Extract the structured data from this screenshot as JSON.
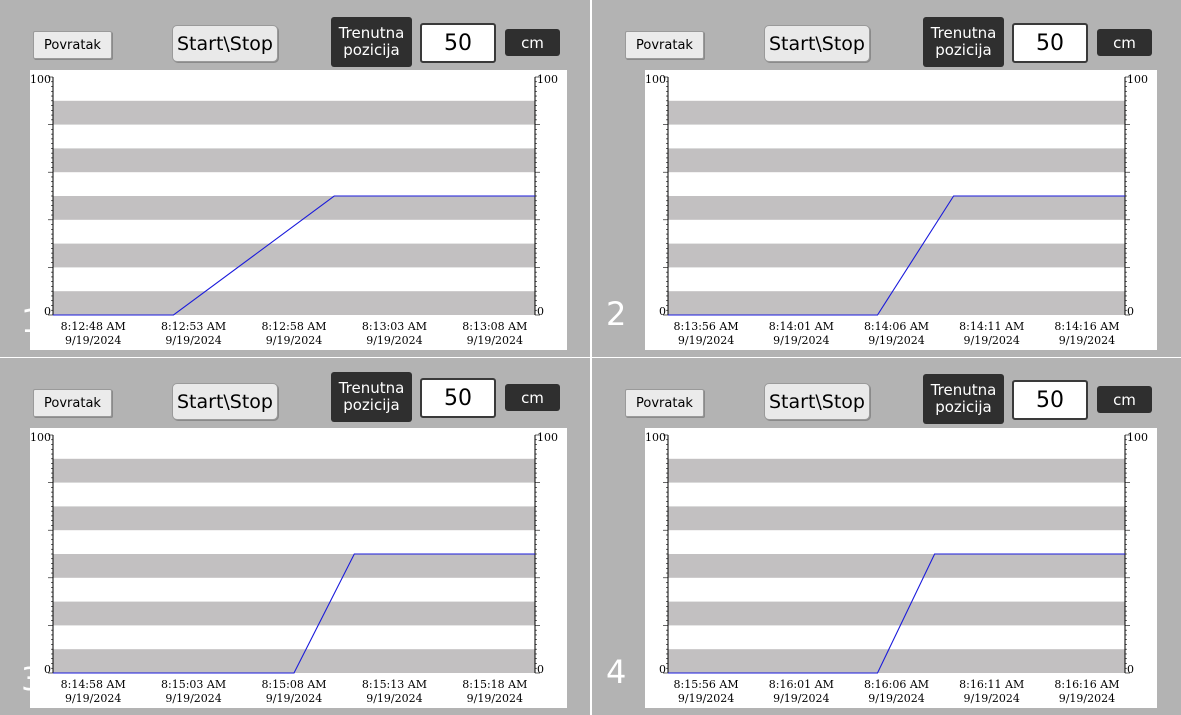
{
  "panels": [
    {
      "number": "1",
      "back_label": "Povratak",
      "startstop_label": "Start\\Stop",
      "position_label": "Trenutna\npozicija",
      "position_value": "50",
      "unit": "cm",
      "chart_data": {
        "type": "line",
        "y_left_labels": [
          "100",
          "0"
        ],
        "y_right_labels": [
          "100",
          "0"
        ],
        "ylim": [
          0,
          100
        ],
        "x_ticks": [
          {
            "time": "8:12:48 AM",
            "date": "9/19/2024"
          },
          {
            "time": "8:12:53 AM",
            "date": "9/19/2024"
          },
          {
            "time": "8:12:58 AM",
            "date": "9/19/2024"
          },
          {
            "time": "8:13:03 AM",
            "date": "9/19/2024"
          },
          {
            "time": "8:13:08 AM",
            "date": "9/19/2024"
          }
        ],
        "series": [
          {
            "color": "#1a1adb",
            "points": [
              [
                "8:12:46 AM",
                0
              ],
              [
                "8:12:52 AM",
                0
              ],
              [
                "8:13:00 AM",
                50
              ],
              [
                "8:13:10 AM",
                50
              ]
            ]
          }
        ],
        "grid": "alternating bands"
      }
    },
    {
      "number": "2",
      "back_label": "Povratak",
      "startstop_label": "Start\\Stop",
      "position_label": "Trenutna\npozicija",
      "position_value": "50",
      "unit": "cm",
      "chart_data": {
        "type": "line",
        "y_left_labels": [
          "100",
          "0"
        ],
        "y_right_labels": [
          "100",
          "0"
        ],
        "ylim": [
          0,
          100
        ],
        "x_ticks": [
          {
            "time": "8:13:56 AM",
            "date": "9/19/2024"
          },
          {
            "time": "8:14:01 AM",
            "date": "9/19/2024"
          },
          {
            "time": "8:14:06 AM",
            "date": "9/19/2024"
          },
          {
            "time": "8:14:11 AM",
            "date": "9/19/2024"
          },
          {
            "time": "8:14:16 AM",
            "date": "9/19/2024"
          }
        ],
        "series": [
          {
            "color": "#1a1adb",
            "points": [
              [
                "8:13:54 AM",
                0
              ],
              [
                "8:14:05 AM",
                0
              ],
              [
                "8:14:09 AM",
                50
              ],
              [
                "8:14:18 AM",
                50
              ]
            ]
          }
        ],
        "grid": "alternating bands"
      }
    },
    {
      "number": "3",
      "back_label": "Povratak",
      "startstop_label": "Start\\Stop",
      "position_label": "Trenutna\npozicija",
      "position_value": "50",
      "unit": "cm",
      "chart_data": {
        "type": "line",
        "y_left_labels": [
          "100",
          "0"
        ],
        "y_right_labels": [
          "100",
          "0"
        ],
        "ylim": [
          0,
          100
        ],
        "x_ticks": [
          {
            "time": "8:14:58 AM",
            "date": "9/19/2024"
          },
          {
            "time": "8:15:03 AM",
            "date": "9/19/2024"
          },
          {
            "time": "8:15:08 AM",
            "date": "9/19/2024"
          },
          {
            "time": "8:15:13 AM",
            "date": "9/19/2024"
          },
          {
            "time": "8:15:18 AM",
            "date": "9/19/2024"
          }
        ],
        "series": [
          {
            "color": "#1a1adb",
            "points": [
              [
                "8:14:56 AM",
                0
              ],
              [
                "8:15:08 AM",
                0
              ],
              [
                "8:15:11 AM",
                50
              ],
              [
                "8:15:20 AM",
                50
              ]
            ]
          }
        ],
        "grid": "alternating bands"
      }
    },
    {
      "number": "4",
      "back_label": "Povratak",
      "startstop_label": "Start\\Stop",
      "position_label": "Trenutna\npozicija",
      "position_value": "50",
      "unit": "cm",
      "chart_data": {
        "type": "line",
        "y_left_labels": [
          "100",
          "0"
        ],
        "y_right_labels": [
          "100",
          "0"
        ],
        "ylim": [
          0,
          100
        ],
        "x_ticks": [
          {
            "time": "8:15:56 AM",
            "date": "9/19/2024"
          },
          {
            "time": "8:16:01 AM",
            "date": "9/19/2024"
          },
          {
            "time": "8:16:06 AM",
            "date": "9/19/2024"
          },
          {
            "time": "8:16:11 AM",
            "date": "9/19/2024"
          },
          {
            "time": "8:16:16 AM",
            "date": "9/19/2024"
          }
        ],
        "series": [
          {
            "color": "#1a1adb",
            "points": [
              [
                "8:15:54 AM",
                0
              ],
              [
                "8:16:05 AM",
                0
              ],
              [
                "8:16:08 AM",
                50
              ],
              [
                "8:16:18 AM",
                50
              ]
            ]
          }
        ],
        "grid": "alternating bands"
      }
    }
  ]
}
